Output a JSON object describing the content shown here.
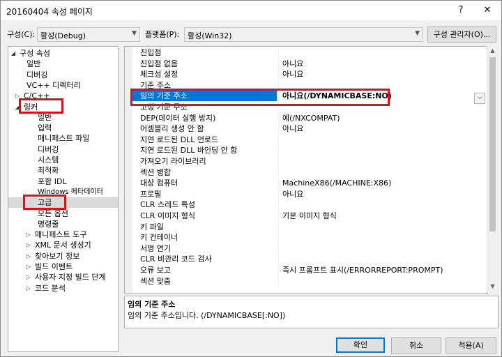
{
  "window": {
    "title": "20160404 속성 페이지",
    "help_glyph": "?",
    "close_glyph": "✕"
  },
  "config": {
    "config_label": "구성(C):",
    "config_value": "활성(Debug)",
    "platform_label": "플랫폼(P):",
    "platform_value": "활성(Win32)",
    "manager_button": "구성 관리자(O)..."
  },
  "tree": {
    "items": [
      {
        "label": "구성 속성",
        "expander": "◢"
      },
      {
        "label": "일반"
      },
      {
        "label": "디버깅"
      },
      {
        "label": "VC++ 디렉터리"
      },
      {
        "label": "C/C++",
        "expander": "▷"
      },
      {
        "label": "링커",
        "expander": "◢"
      },
      {
        "label": "일반"
      },
      {
        "label": "입력"
      },
      {
        "label": "매니페스트 파일"
      },
      {
        "label": "디버깅"
      },
      {
        "label": "시스템"
      },
      {
        "label": "최적화"
      },
      {
        "label": "포함 IDL"
      },
      {
        "label": "Windows 메타데이터"
      },
      {
        "label": "고급"
      },
      {
        "label": "모든 옵션"
      },
      {
        "label": "명령줄"
      },
      {
        "label": "매니페스트 도구",
        "expander": "▷"
      },
      {
        "label": "XML 문서 생성기",
        "expander": "▷"
      },
      {
        "label": "찾아보기 정보",
        "expander": "▷"
      },
      {
        "label": "빌드 이벤트",
        "expander": "▷"
      },
      {
        "label": "사용자 지정 빌드 단계",
        "expander": "▷"
      },
      {
        "label": "코드 분석",
        "expander": "▷"
      }
    ]
  },
  "grid": {
    "rows": [
      {
        "key": "진입점",
        "value": ""
      },
      {
        "key": "진입점 없음",
        "value": "아니요"
      },
      {
        "key": "체크섬 설정",
        "value": "아니요"
      },
      {
        "key": "기준 주소",
        "value": ""
      },
      {
        "key": "임의 기준 주소",
        "value": "아니요(/DYNAMICBASE:NO)"
      },
      {
        "key": "고정 기준 주소",
        "value": ""
      },
      {
        "key": "DEP(데이터 실행 방지)",
        "value": "예(/NXCOMPAT)"
      },
      {
        "key": "어셈블리 생성 안 함",
        "value": "아니요"
      },
      {
        "key": "지연 로드된 DLL 언로드",
        "value": ""
      },
      {
        "key": "지연 로드된 DLL 바인딩 안 함",
        "value": ""
      },
      {
        "key": "가져오기 라이브러리",
        "value": ""
      },
      {
        "key": "섹션 병합",
        "value": ""
      },
      {
        "key": "대상 컴퓨터",
        "value": "MachineX86(/MACHINE:X86)"
      },
      {
        "key": "프로필",
        "value": "아니요"
      },
      {
        "key": "CLR 스레드 특성",
        "value": ""
      },
      {
        "key": "CLR 이미지 형식",
        "value": "기본 이미지 형식"
      },
      {
        "key": "키 파일",
        "value": ""
      },
      {
        "key": "키 컨테이너",
        "value": ""
      },
      {
        "key": "서명 연기",
        "value": ""
      },
      {
        "key": "CLR 비관리 코드 검사",
        "value": ""
      },
      {
        "key": "오류 보고",
        "value": "즉시 프롬프트 표시(/ERRORREPORT:PROMPT)"
      },
      {
        "key": "섹션 맞춤",
        "value": ""
      }
    ],
    "dropdown_glyph": "⌵"
  },
  "description": {
    "title": "임의 기준 주소",
    "text": "임의 기준 주소입니다. (/DYNAMICBASE[:NO])"
  },
  "buttons": {
    "ok": "확인",
    "cancel": "취소",
    "apply": "적용(A)"
  },
  "colors": {
    "highlight": "#e0101a",
    "selection": "#0078d7"
  }
}
